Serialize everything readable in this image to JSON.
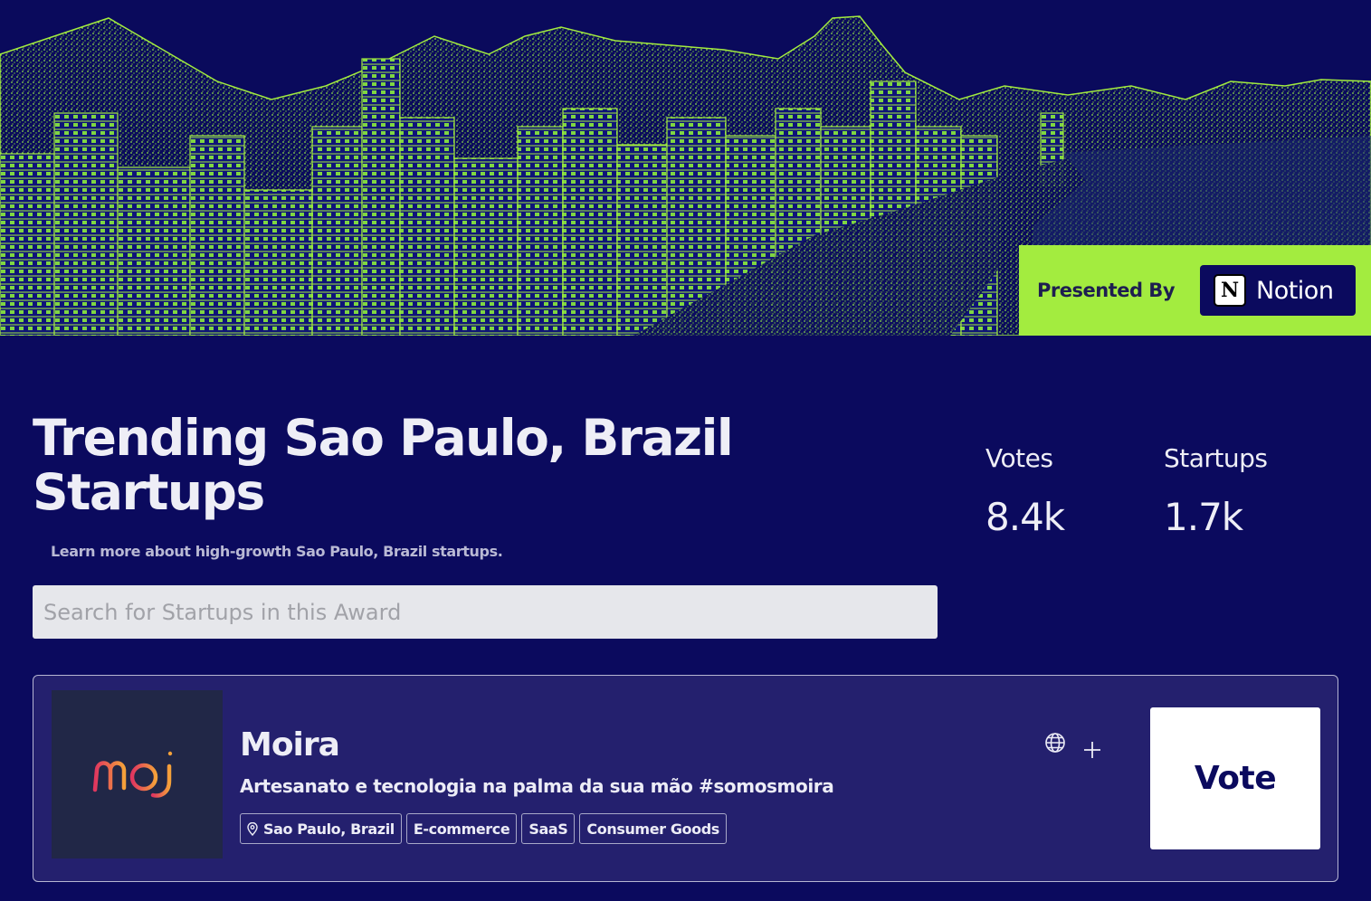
{
  "hero": {
    "image_alt": "Rio de Janeiro skyline with Sugarloaf Mountain and Copacabana beach, green on navy",
    "presented_by_label": "Presented By",
    "sponsor": {
      "logo_letter": "N",
      "name": "Notion"
    }
  },
  "header": {
    "title": "Trending Sao Paulo, Brazil Startups",
    "subtitle": "Learn more about high-growth Sao Paulo, Brazil startups."
  },
  "stats": [
    {
      "label": "Votes",
      "value": "8.4k"
    },
    {
      "label": "Startups",
      "value": "1.7k"
    }
  ],
  "search": {
    "placeholder": "Search for Startups in this Award",
    "value": ""
  },
  "startups": [
    {
      "name": "Moira",
      "logo_text": "moi",
      "description": "Artesanato e tecnologia na palma da sua mão #somosmoira",
      "tags": [
        "Sao Paulo, Brazil",
        "E-commerce",
        "SaaS",
        "Consumer Goods"
      ],
      "vote_label": "Vote"
    }
  ],
  "colors": {
    "background": "#0b0a5e",
    "accent_green": "#a3ec3f",
    "card": "#24206e",
    "logo_gradient": [
      "#e0365f",
      "#f4a13a"
    ]
  }
}
